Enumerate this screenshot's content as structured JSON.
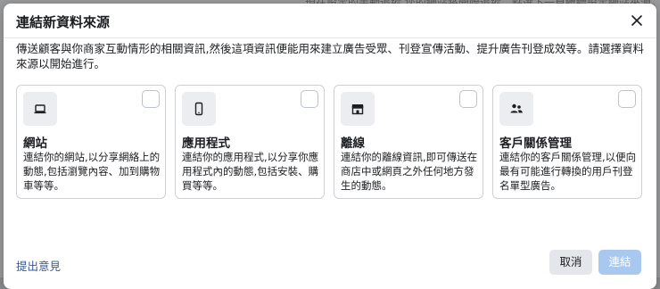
{
  "background": {
    "partial_text": "…現在設定的手動追蹤,您的網站將開始追蹤。點選下一頁繼續設定網站來源。"
  },
  "dialog": {
    "title": "連結新資料來源",
    "close_icon": "close-icon",
    "description": "傳送顧客與你商家互動情形的相關資訊,然後這項資訊便能用來建立廣告受眾、刊登宣傳活動、提升廣告刊登成效等。請選擇資料來源以開始進行。"
  },
  "sources": [
    {
      "icon": "laptop-icon",
      "title": "網站",
      "description": "連結你的網站,以分享網絡上的動態,包括瀏覽內容、加到購物車等等。",
      "selected": false
    },
    {
      "icon": "mobile-phone-icon",
      "title": "應用程式",
      "description": "連結你的應用程式,以分享你應用程式內的動態,包括安裝、購買等等。",
      "selected": false
    },
    {
      "icon": "storefront-icon",
      "title": "離線",
      "description": "連結你的離線資訊,即可傳送在商店中或網頁之外任何地方發生的動態。",
      "selected": false
    },
    {
      "icon": "contacts-icon",
      "title": "客戶關係管理",
      "description": "連結你的客戶關係管理,以便向最有可能進行轉換的用戶刊登名單型廣告。",
      "selected": false
    }
  ],
  "footer": {
    "feedback_label": "提出意見",
    "cancel_label": "取消",
    "connect_label": "連結"
  },
  "colors": {
    "link": "#385898",
    "primary_disabled": "#a8c8f0",
    "secondary_button": "#e4e6eb",
    "border": "#ced0d4"
  }
}
